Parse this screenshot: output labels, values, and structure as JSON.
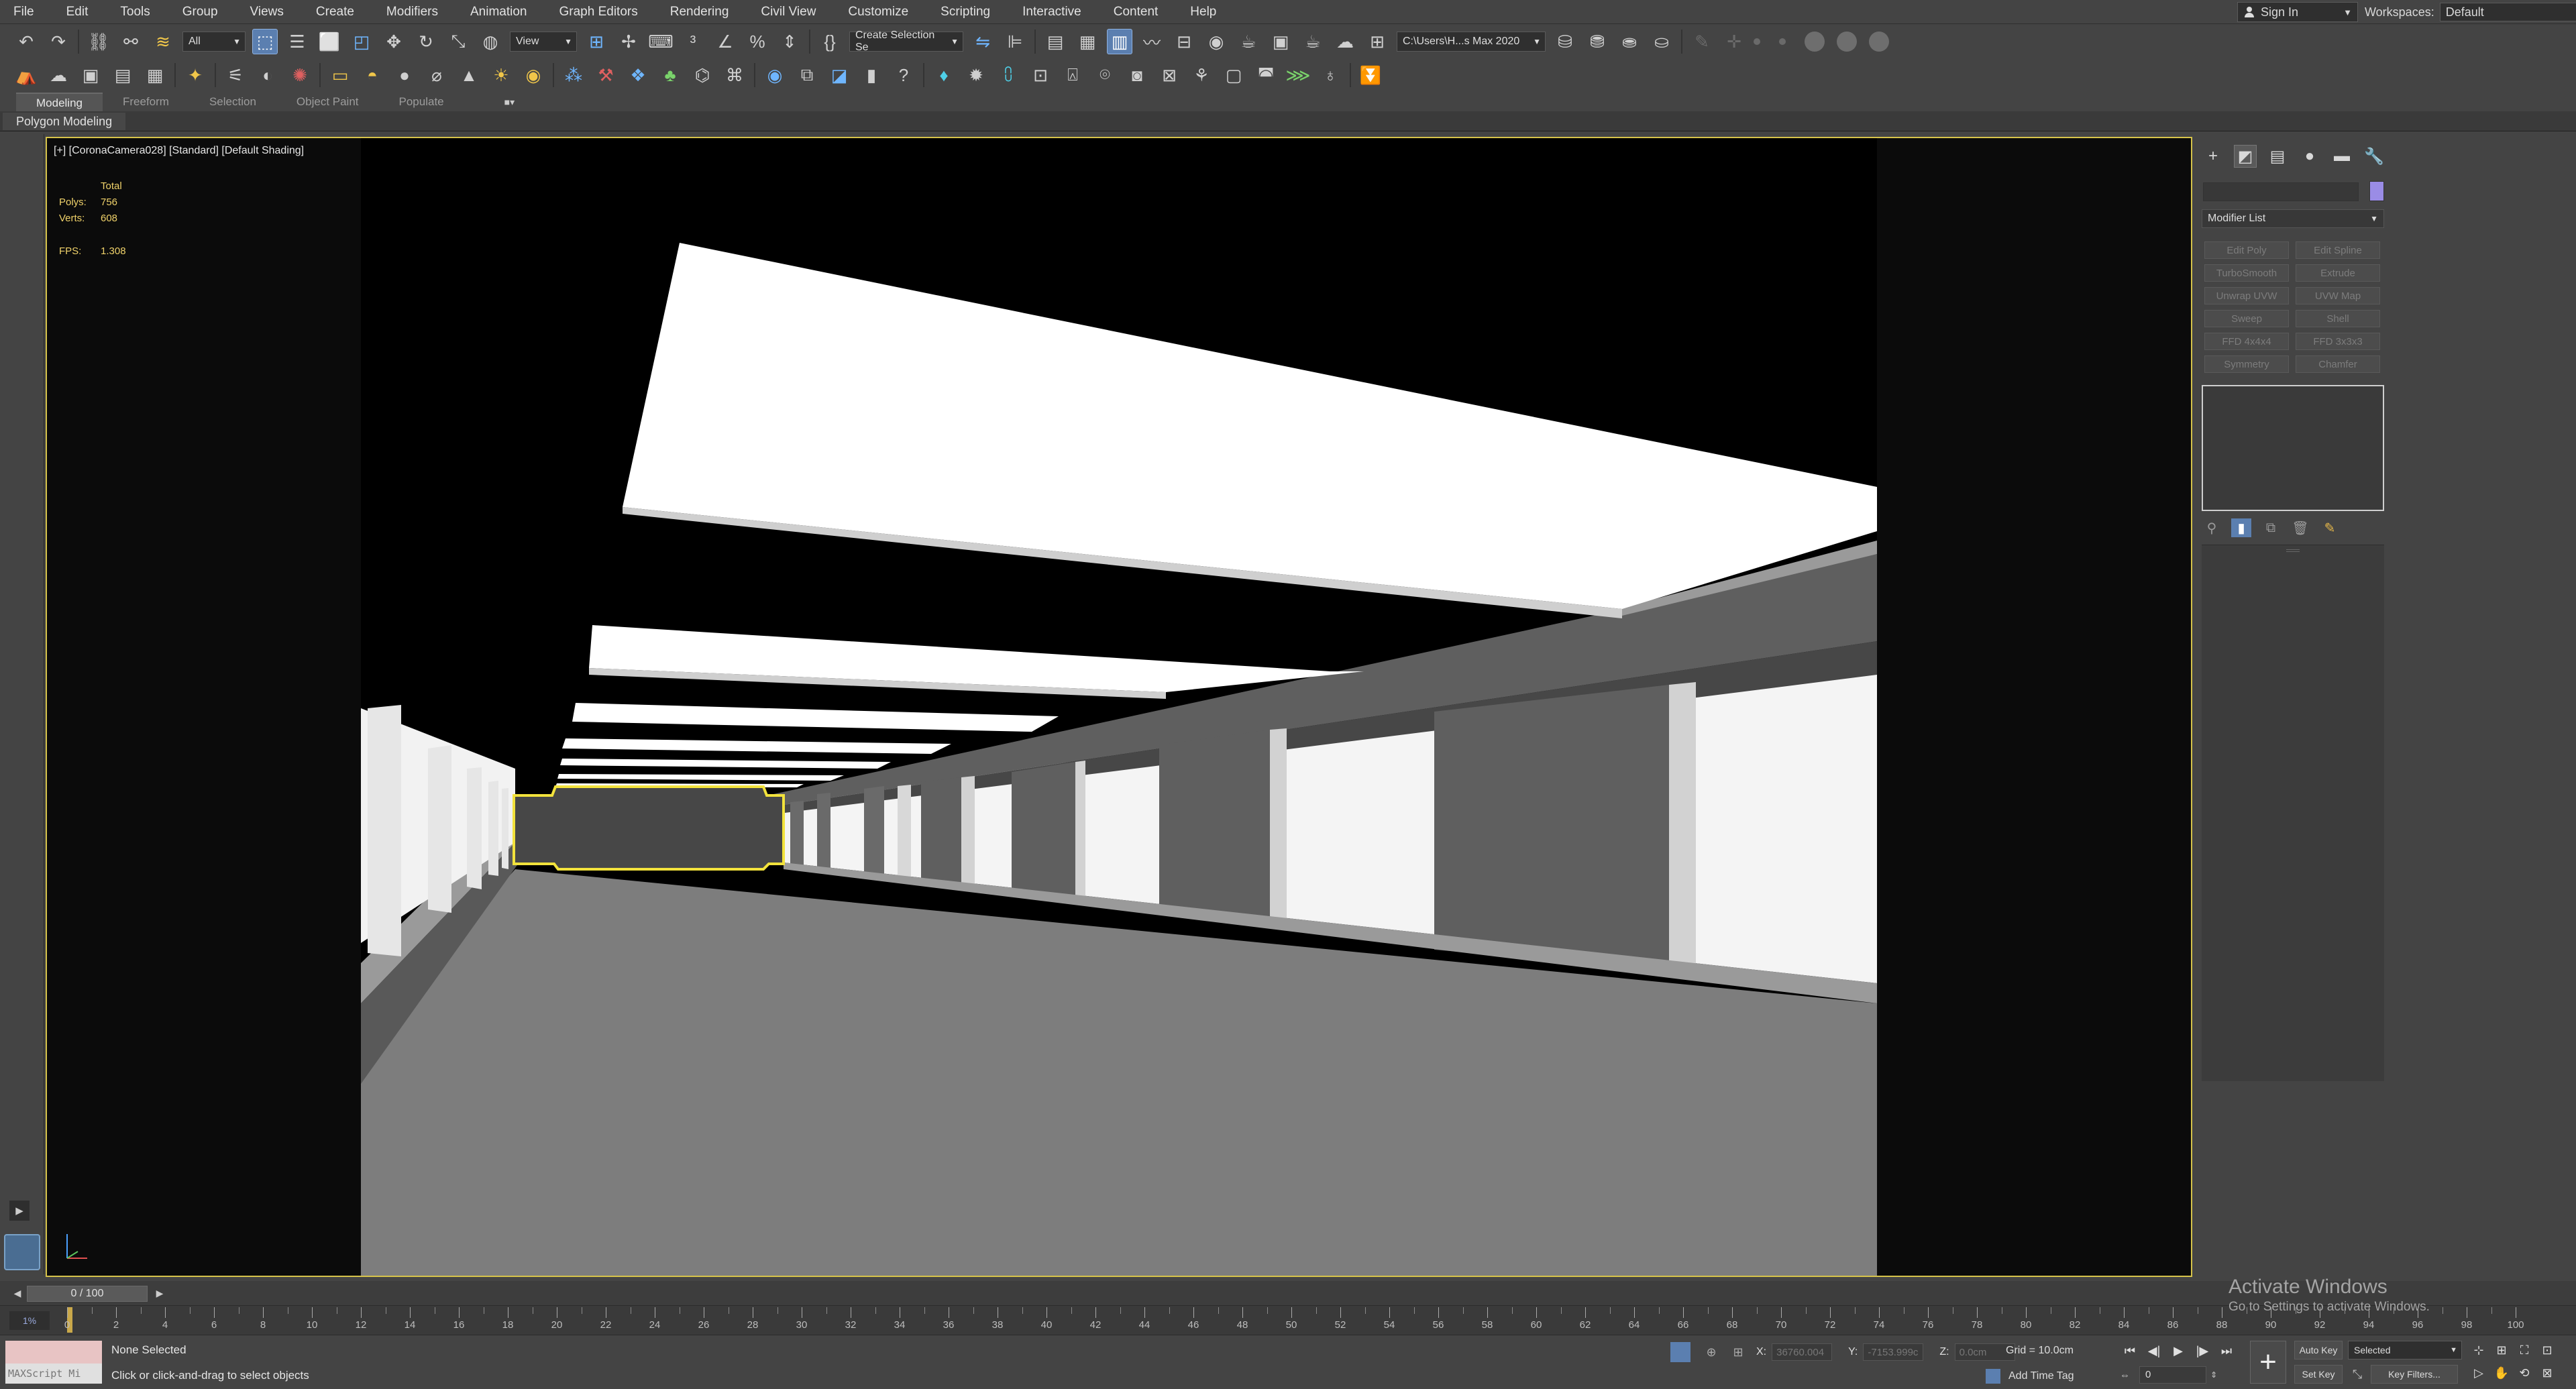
{
  "menu": [
    "File",
    "Edit",
    "Tools",
    "Group",
    "Views",
    "Create",
    "Modifiers",
    "Animation",
    "Graph Editors",
    "Rendering",
    "Civil View",
    "Customize",
    "Scripting",
    "Interactive",
    "Content",
    "Help"
  ],
  "account": {
    "sign_in_label": "Sign In",
    "workspaces_label": "Workspaces:",
    "workspace_value": "Default"
  },
  "toolbar": {
    "filter_value": "All",
    "ref_coord_value": "View",
    "selection_set_value": "Create Selection Se",
    "project_path": "C:\\Users\\H...s Max 2020"
  },
  "ribbon": {
    "tabs": [
      "Modeling",
      "Freeform",
      "Selection",
      "Object Paint",
      "Populate"
    ],
    "active_tab": "Modeling",
    "panel_label": "Polygon Modeling"
  },
  "viewport": {
    "label": "[+] [CoronaCamera028] [Standard] [Default Shading]",
    "stats": {
      "total_label": "Total",
      "polys_label": "Polys:",
      "polys_value": "756",
      "verts_label": "Verts:",
      "verts_value": "608",
      "fps_label": "FPS:",
      "fps_value": "1.308"
    }
  },
  "command_panel": {
    "modifier_list_label": "Modifier List",
    "modifier_buttons": [
      "Edit Poly",
      "Edit Spline",
      "TurboSmooth",
      "Extrude",
      "Unwrap UVW",
      "UVW Map",
      "Sweep",
      "Shell",
      "FFD 4x4x4",
      "FFD 3x3x3",
      "Symmetry",
      "Chamfer"
    ]
  },
  "timeline": {
    "frame_display": "0 / 100",
    "tick_labels": [
      "0",
      "2",
      "4",
      "6",
      "8",
      "10",
      "12",
      "14",
      "16",
      "18",
      "20",
      "22",
      "24",
      "26",
      "28",
      "30",
      "32",
      "34",
      "36",
      "38",
      "40",
      "42",
      "44",
      "46",
      "48",
      "50",
      "52",
      "54",
      "56",
      "58",
      "60",
      "62",
      "64",
      "66",
      "68",
      "70",
      "72",
      "74",
      "76",
      "78",
      "80",
      "82",
      "84",
      "86",
      "88",
      "90",
      "92",
      "94",
      "96",
      "98",
      "100"
    ],
    "trackbar_icon_text": "1%"
  },
  "status": {
    "maxscript_label": "MAXScript Mi",
    "selection_status": "None Selected",
    "prompt": "Click or click-and-drag to select objects",
    "x_label": "X:",
    "x_value": "36760.004",
    "y_label": "Y:",
    "y_value": "-7153.999c",
    "z_label": "Z:",
    "z_value": "0.0cm",
    "grid_label": "Grid = 10.0cm",
    "add_time_tag": "Add Time Tag",
    "current_frame": "0",
    "auto_key": "Auto Key",
    "set_key": "Set Key",
    "key_mode_value": "Selected",
    "key_filters": "Key Filters..."
  },
  "watermark": {
    "title": "Activate Windows",
    "subtitle": "Go to Settings to activate Windows."
  },
  "colors": {
    "selection_highlight": "#f2e23c",
    "viewport_border": "#d6c34a",
    "active_button": "#5b7fb0",
    "stats_text": "#f0d26a"
  }
}
